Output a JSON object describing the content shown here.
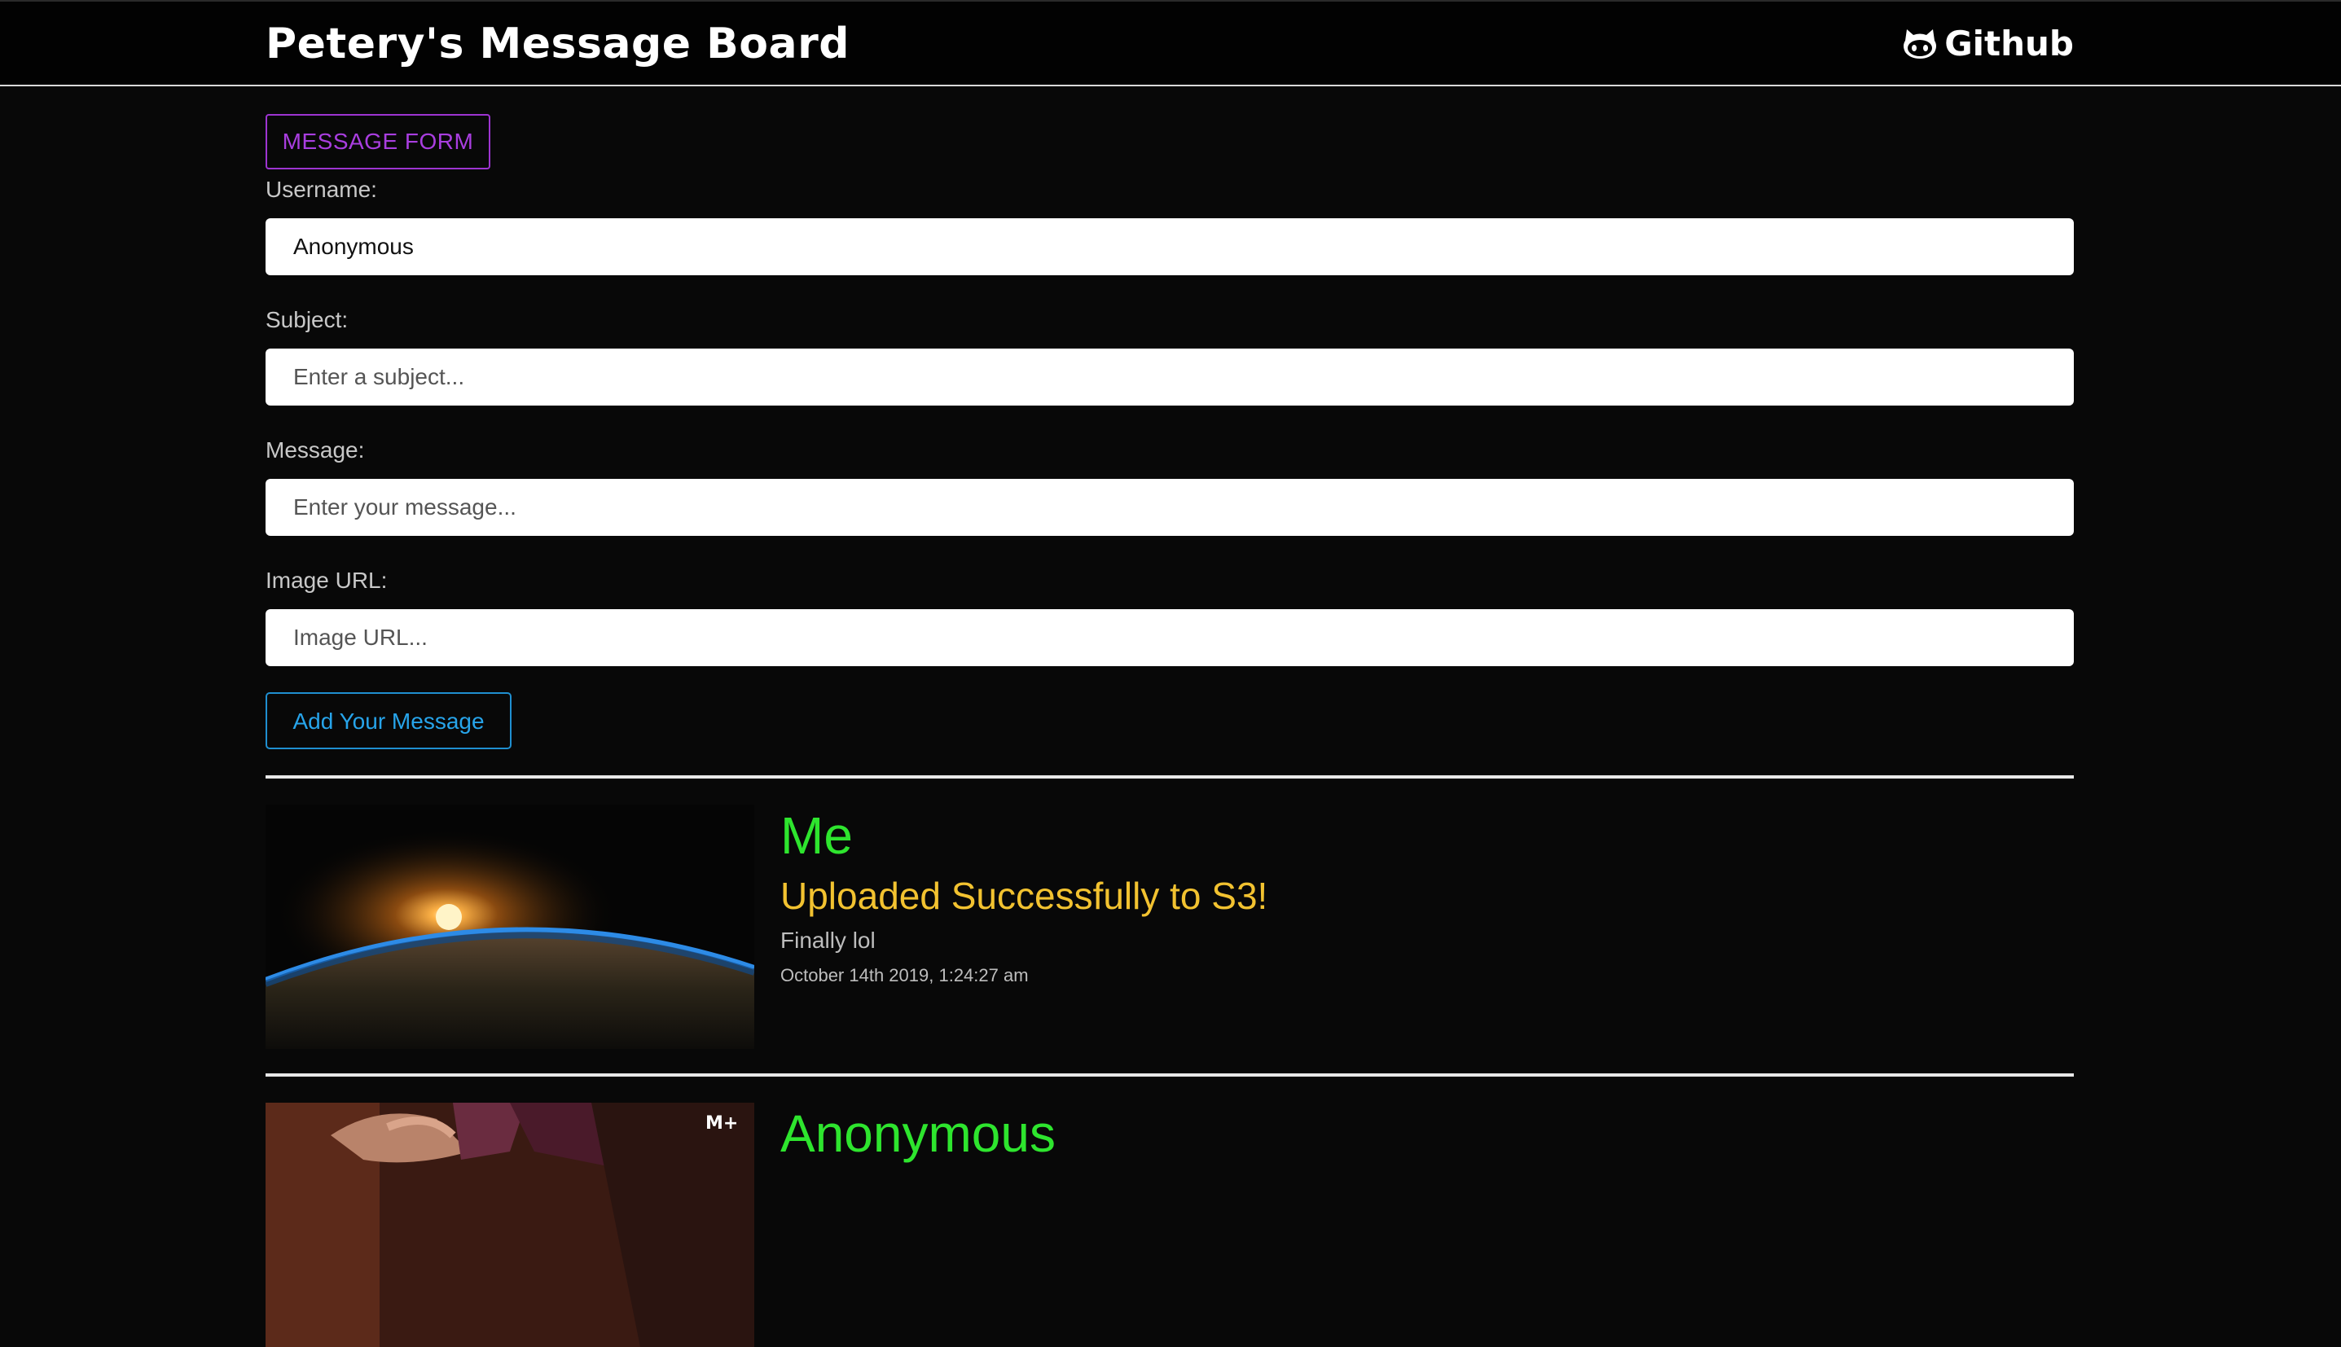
{
  "header": {
    "title": "Petery's Message Board",
    "github_label": "Github"
  },
  "form": {
    "tab_label": "MESSAGE FORM",
    "username": {
      "label": "Username:",
      "value": "Anonymous",
      "placeholder": ""
    },
    "subject": {
      "label": "Subject:",
      "value": "",
      "placeholder": "Enter a subject..."
    },
    "message": {
      "label": "Message:",
      "value": "",
      "placeholder": "Enter your message..."
    },
    "image_url": {
      "label": "Image URL:",
      "value": "",
      "placeholder": "Image URL..."
    },
    "submit_label": "Add Your Message"
  },
  "messages": [
    {
      "author": "Me",
      "subject": "Uploaded Successfully to S3!",
      "message": "Finally lol",
      "timestamp": "October 14th 2019, 1:24:27 am",
      "image": "earth-sunrise-image"
    },
    {
      "author": "Anonymous",
      "subject": "",
      "message": "",
      "timestamp": "",
      "image": "video-still-image",
      "watermark": "M+"
    }
  ],
  "colors": {
    "background": "#080808",
    "tab_accent": "#a93ee0",
    "button_accent": "#27a4ea",
    "author": "#2ee52e",
    "subject": "#f2c230"
  }
}
